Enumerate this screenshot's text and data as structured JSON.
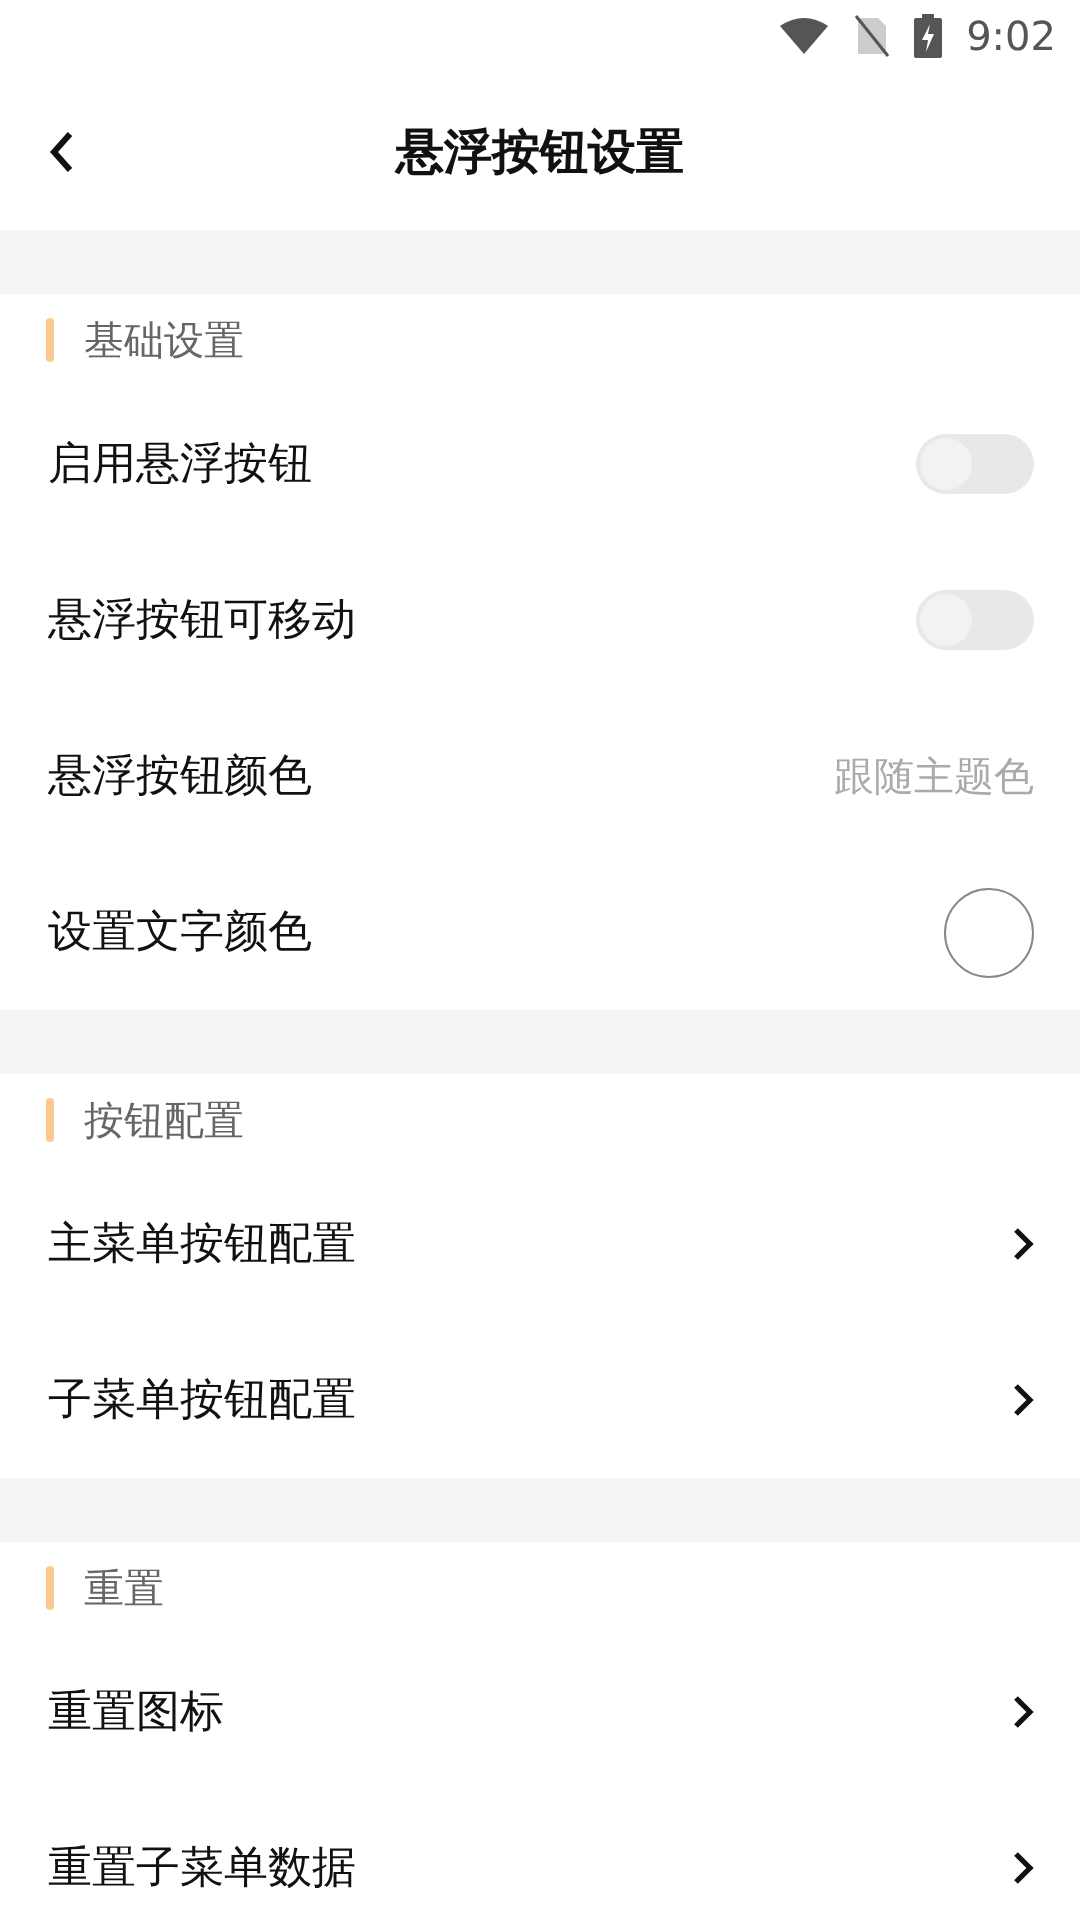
{
  "status_bar": {
    "time": "9:02"
  },
  "header": {
    "title": "悬浮按钮设置"
  },
  "sections": [
    {
      "title": "基础设置",
      "rows": [
        {
          "kind": "toggle",
          "label": "启用悬浮按钮",
          "on": false
        },
        {
          "kind": "toggle",
          "label": "悬浮按钮可移动",
          "on": false
        },
        {
          "kind": "value",
          "label": "悬浮按钮颜色",
          "value": "跟随主题色"
        },
        {
          "kind": "color",
          "label": "设置文字颜色",
          "color": "#ffffff"
        }
      ]
    },
    {
      "title": "按钮配置",
      "rows": [
        {
          "kind": "link",
          "label": "主菜单按钮配置"
        },
        {
          "kind": "link",
          "label": "子菜单按钮配置"
        }
      ]
    },
    {
      "title": "重置",
      "rows": [
        {
          "kind": "link",
          "label": "重置图标"
        },
        {
          "kind": "link",
          "label": "重置子菜单数据"
        }
      ]
    }
  ]
}
